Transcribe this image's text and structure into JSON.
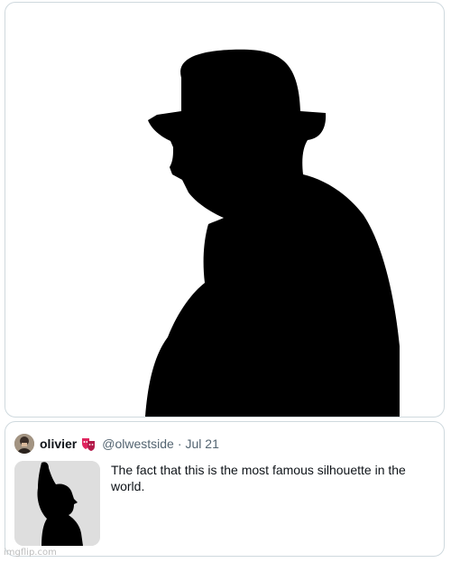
{
  "tweet": {
    "display_name": "olivier",
    "badge_icon": "mask-icon",
    "handle": "@olwestside",
    "separator": "·",
    "date": "Jul 21",
    "text": "The fact that this is the most famous silhouette in the world."
  },
  "watermark": "imgflip.com",
  "colors": {
    "border": "#cfd9de",
    "secondary_text": "#536471",
    "primary_text": "#0f1419",
    "badge_red": "#e0245e"
  }
}
